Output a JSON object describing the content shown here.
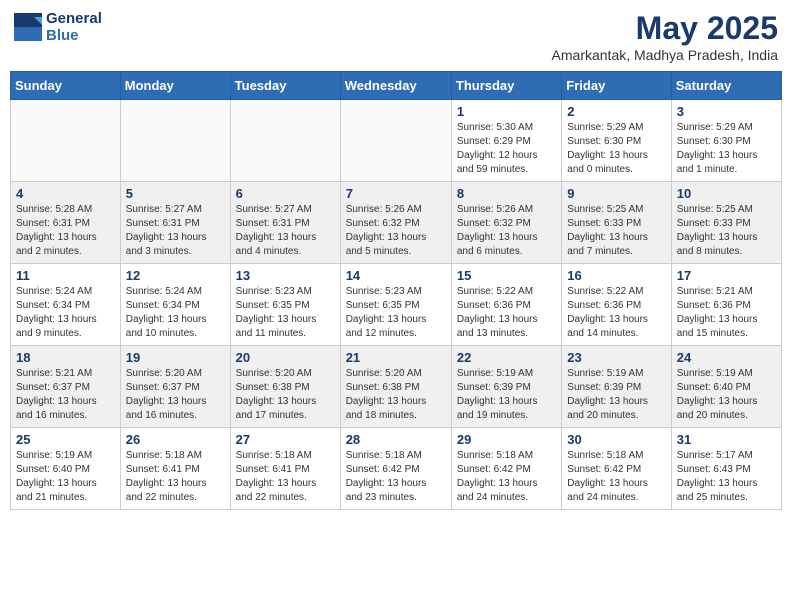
{
  "header": {
    "logo_line1": "General",
    "logo_line2": "Blue",
    "month_year": "May 2025",
    "location": "Amarkantak, Madhya Pradesh, India"
  },
  "weekdays": [
    "Sunday",
    "Monday",
    "Tuesday",
    "Wednesday",
    "Thursday",
    "Friday",
    "Saturday"
  ],
  "weeks": [
    [
      {
        "day": "",
        "info": ""
      },
      {
        "day": "",
        "info": ""
      },
      {
        "day": "",
        "info": ""
      },
      {
        "day": "",
        "info": ""
      },
      {
        "day": "1",
        "info": "Sunrise: 5:30 AM\nSunset: 6:29 PM\nDaylight: 12 hours\nand 59 minutes."
      },
      {
        "day": "2",
        "info": "Sunrise: 5:29 AM\nSunset: 6:30 PM\nDaylight: 13 hours\nand 0 minutes."
      },
      {
        "day": "3",
        "info": "Sunrise: 5:29 AM\nSunset: 6:30 PM\nDaylight: 13 hours\nand 1 minute."
      }
    ],
    [
      {
        "day": "4",
        "info": "Sunrise: 5:28 AM\nSunset: 6:31 PM\nDaylight: 13 hours\nand 2 minutes."
      },
      {
        "day": "5",
        "info": "Sunrise: 5:27 AM\nSunset: 6:31 PM\nDaylight: 13 hours\nand 3 minutes."
      },
      {
        "day": "6",
        "info": "Sunrise: 5:27 AM\nSunset: 6:31 PM\nDaylight: 13 hours\nand 4 minutes."
      },
      {
        "day": "7",
        "info": "Sunrise: 5:26 AM\nSunset: 6:32 PM\nDaylight: 13 hours\nand 5 minutes."
      },
      {
        "day": "8",
        "info": "Sunrise: 5:26 AM\nSunset: 6:32 PM\nDaylight: 13 hours\nand 6 minutes."
      },
      {
        "day": "9",
        "info": "Sunrise: 5:25 AM\nSunset: 6:33 PM\nDaylight: 13 hours\nand 7 minutes."
      },
      {
        "day": "10",
        "info": "Sunrise: 5:25 AM\nSunset: 6:33 PM\nDaylight: 13 hours\nand 8 minutes."
      }
    ],
    [
      {
        "day": "11",
        "info": "Sunrise: 5:24 AM\nSunset: 6:34 PM\nDaylight: 13 hours\nand 9 minutes."
      },
      {
        "day": "12",
        "info": "Sunrise: 5:24 AM\nSunset: 6:34 PM\nDaylight: 13 hours\nand 10 minutes."
      },
      {
        "day": "13",
        "info": "Sunrise: 5:23 AM\nSunset: 6:35 PM\nDaylight: 13 hours\nand 11 minutes."
      },
      {
        "day": "14",
        "info": "Sunrise: 5:23 AM\nSunset: 6:35 PM\nDaylight: 13 hours\nand 12 minutes."
      },
      {
        "day": "15",
        "info": "Sunrise: 5:22 AM\nSunset: 6:36 PM\nDaylight: 13 hours\nand 13 minutes."
      },
      {
        "day": "16",
        "info": "Sunrise: 5:22 AM\nSunset: 6:36 PM\nDaylight: 13 hours\nand 14 minutes."
      },
      {
        "day": "17",
        "info": "Sunrise: 5:21 AM\nSunset: 6:36 PM\nDaylight: 13 hours\nand 15 minutes."
      }
    ],
    [
      {
        "day": "18",
        "info": "Sunrise: 5:21 AM\nSunset: 6:37 PM\nDaylight: 13 hours\nand 16 minutes."
      },
      {
        "day": "19",
        "info": "Sunrise: 5:20 AM\nSunset: 6:37 PM\nDaylight: 13 hours\nand 16 minutes."
      },
      {
        "day": "20",
        "info": "Sunrise: 5:20 AM\nSunset: 6:38 PM\nDaylight: 13 hours\nand 17 minutes."
      },
      {
        "day": "21",
        "info": "Sunrise: 5:20 AM\nSunset: 6:38 PM\nDaylight: 13 hours\nand 18 minutes."
      },
      {
        "day": "22",
        "info": "Sunrise: 5:19 AM\nSunset: 6:39 PM\nDaylight: 13 hours\nand 19 minutes."
      },
      {
        "day": "23",
        "info": "Sunrise: 5:19 AM\nSunset: 6:39 PM\nDaylight: 13 hours\nand 20 minutes."
      },
      {
        "day": "24",
        "info": "Sunrise: 5:19 AM\nSunset: 6:40 PM\nDaylight: 13 hours\nand 20 minutes."
      }
    ],
    [
      {
        "day": "25",
        "info": "Sunrise: 5:19 AM\nSunset: 6:40 PM\nDaylight: 13 hours\nand 21 minutes."
      },
      {
        "day": "26",
        "info": "Sunrise: 5:18 AM\nSunset: 6:41 PM\nDaylight: 13 hours\nand 22 minutes."
      },
      {
        "day": "27",
        "info": "Sunrise: 5:18 AM\nSunset: 6:41 PM\nDaylight: 13 hours\nand 22 minutes."
      },
      {
        "day": "28",
        "info": "Sunrise: 5:18 AM\nSunset: 6:42 PM\nDaylight: 13 hours\nand 23 minutes."
      },
      {
        "day": "29",
        "info": "Sunrise: 5:18 AM\nSunset: 6:42 PM\nDaylight: 13 hours\nand 24 minutes."
      },
      {
        "day": "30",
        "info": "Sunrise: 5:18 AM\nSunset: 6:42 PM\nDaylight: 13 hours\nand 24 minutes."
      },
      {
        "day": "31",
        "info": "Sunrise: 5:17 AM\nSunset: 6:43 PM\nDaylight: 13 hours\nand 25 minutes."
      }
    ]
  ]
}
